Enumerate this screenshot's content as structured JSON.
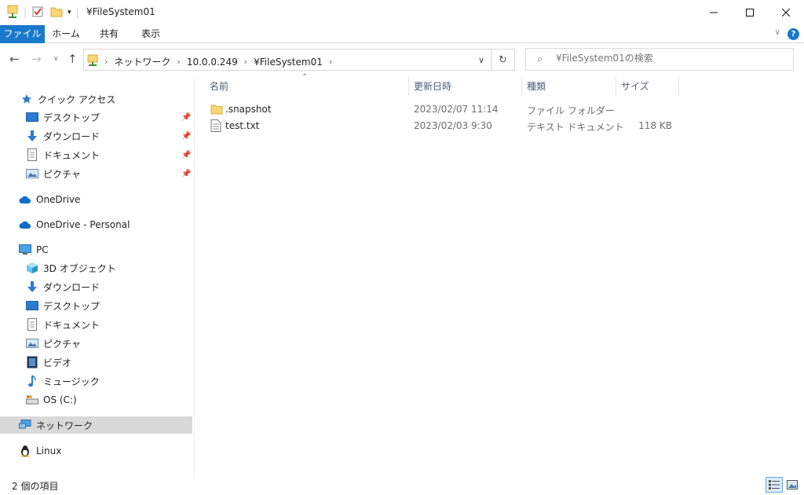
{
  "window": {
    "title": "¥FileSystem01"
  },
  "ribbon": {
    "tabs": [
      "ファイル",
      "ホーム",
      "共有",
      "表示"
    ]
  },
  "address": {
    "crumbs": [
      "ネットワーク",
      "10.0.0.249",
      "¥FileSystem01"
    ]
  },
  "search": {
    "placeholder": "¥FileSystem01の検索"
  },
  "sidebar": {
    "quick_access": "クイック アクセス",
    "quick_items": [
      "デスクトップ",
      "ダウンロード",
      "ドキュメント",
      "ピクチャ"
    ],
    "onedrive": "OneDrive",
    "onedrive_personal": "OneDrive - Personal",
    "pc": "PC",
    "pc_items": [
      "3D オブジェクト",
      "ダウンロード",
      "デスクトップ",
      "ドキュメント",
      "ピクチャ",
      "ビデオ",
      "ミュージック",
      "OS (C:)"
    ],
    "network": "ネットワーク",
    "linux": "Linux"
  },
  "columns": {
    "name": "名前",
    "date": "更新日時",
    "type": "種類",
    "size": "サイズ"
  },
  "files": [
    {
      "name": ".snapshot",
      "date": "2023/02/07 11:14",
      "type": "ファイル フォルダー",
      "size": "",
      "icon": "folder-icon"
    },
    {
      "name": "test.txt",
      "date": "2023/02/03 9:30",
      "type": "テキスト ドキュメント",
      "size": "118 KB",
      "icon": "text-file-icon"
    }
  ],
  "status": {
    "item_count": "2 個の項目"
  },
  "colors": {
    "accent": "#1979ca",
    "folder": "#f8d775",
    "selected": "#d9d9d9"
  }
}
